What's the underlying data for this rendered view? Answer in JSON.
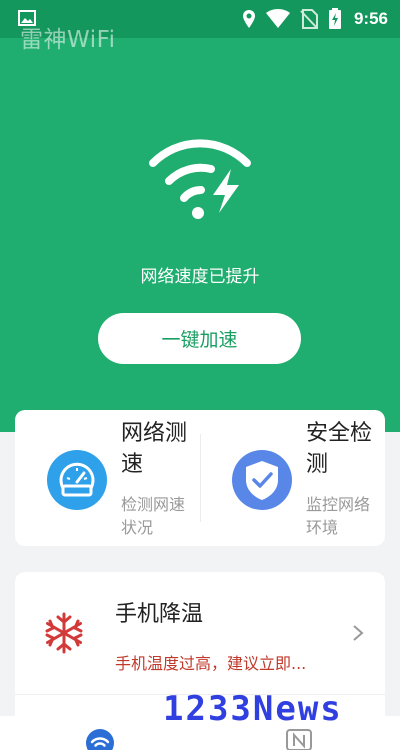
{
  "status_bar": {
    "time": "9:56",
    "icons": [
      "image-icon",
      "location-icon",
      "wifi-signal-icon",
      "no-sim-icon",
      "battery-charging-icon"
    ]
  },
  "header": {
    "title": "雷神WiFi"
  },
  "hero": {
    "icon": "wifi-bolt-icon",
    "status_text": "网络速度已提升",
    "button_label": "一键加速"
  },
  "features": [
    {
      "title": "网络测速",
      "desc": "检测网速状况",
      "icon": "speedometer-icon",
      "color": "#2ea1ea"
    },
    {
      "title": "安全检测",
      "desc": "监控网络环境",
      "icon": "shield-check-icon",
      "color": "#5987e8"
    }
  ],
  "cooling": {
    "title": "手机降温",
    "desc": "手机温度过高，建议立即...",
    "icon": "snowflake-icon",
    "desc_color": "#c0392b"
  },
  "bottom_nav": {
    "items": [
      {
        "icon": "wifi-nav-icon",
        "active": true
      },
      {
        "icon": "news-nav-icon",
        "active": false
      }
    ]
  },
  "watermark": {
    "text": "1233News"
  },
  "colors": {
    "primary": "#1fae6f",
    "status_bar": "#13975d",
    "accent_text": "#1a9f63"
  }
}
